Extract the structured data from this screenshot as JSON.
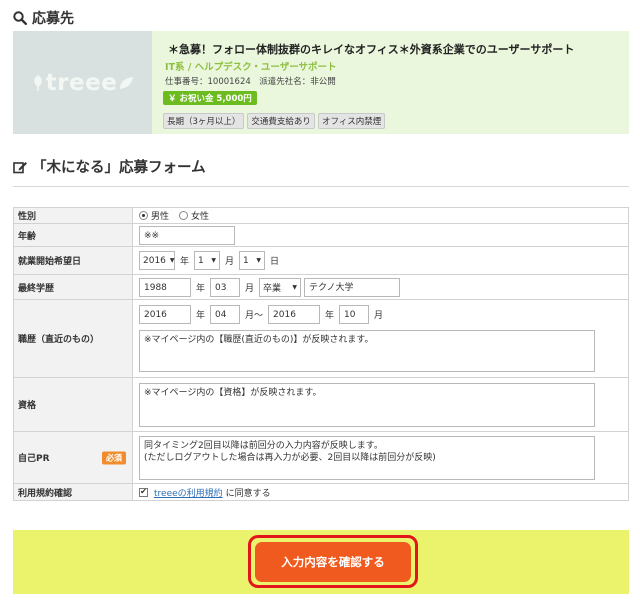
{
  "section1": {
    "icon": "search-icon",
    "title": "応募先"
  },
  "job": {
    "logo": "treee",
    "title": "＊急募！フォロー体制抜群のキレイなオフィス＊外資系企業でのユーザーサポート",
    "category": "IT系 / ヘルプデスク・ユーザーサポート",
    "meta": "仕事番号：10001624　派遣先社名：非公開",
    "reward": "￥ お祝い金 5,000円",
    "tags": [
      "長期（3ヶ月以上）",
      "交通費支給あり",
      "オフィス内禁煙"
    ]
  },
  "section2": {
    "icon": "edit-icon",
    "title": "「木になる」応募フォーム"
  },
  "form": {
    "gender": {
      "label": "性別",
      "options": [
        "男性",
        "女性"
      ],
      "selected": "男性"
    },
    "age": {
      "label": "年齢",
      "value": "※※"
    },
    "start_date": {
      "label": "就業開始希望日",
      "year": "2016",
      "year_unit": "年",
      "month": "1",
      "month_unit": "月",
      "day": "1",
      "day_unit": "日"
    },
    "education": {
      "label": "最終学歴",
      "year": "1988",
      "year_unit": "年",
      "month": "03",
      "month_unit": "月",
      "status": "卒業",
      "school": "テクノ大学"
    },
    "career": {
      "label": "職歴（直近のもの）",
      "from_year": "2016",
      "from_year_unit": "年",
      "from_month": "04",
      "from_month_unit": "月～",
      "to_year": "2016",
      "to_year_unit": "年",
      "to_month": "10",
      "to_month_unit": "月",
      "text": "※マイページ内の【職歴(直近のもの)】が反映されます。"
    },
    "qualification": {
      "label": "資格",
      "text": "※マイページ内の【資格】が反映されます。"
    },
    "self_pr": {
      "label": "自己PR",
      "required": "必須",
      "text_line1": "同タイミング2回目以降は前回分の入力内容が反映します。",
      "text_line2": "(ただしログアウトした場合は再入力が必要、2回目以降は前回分が反映)"
    },
    "terms": {
      "label": "利用規約確認",
      "link": "treeeの利用規約",
      "suffix": "に同意する",
      "checked": true
    }
  },
  "submit": {
    "label": "入力内容を確認する"
  },
  "colors": {
    "accent": "#f05a1e",
    "card_bg": "#eaf7dc",
    "band": "#eaf36b",
    "green": "#6cbb1f"
  }
}
